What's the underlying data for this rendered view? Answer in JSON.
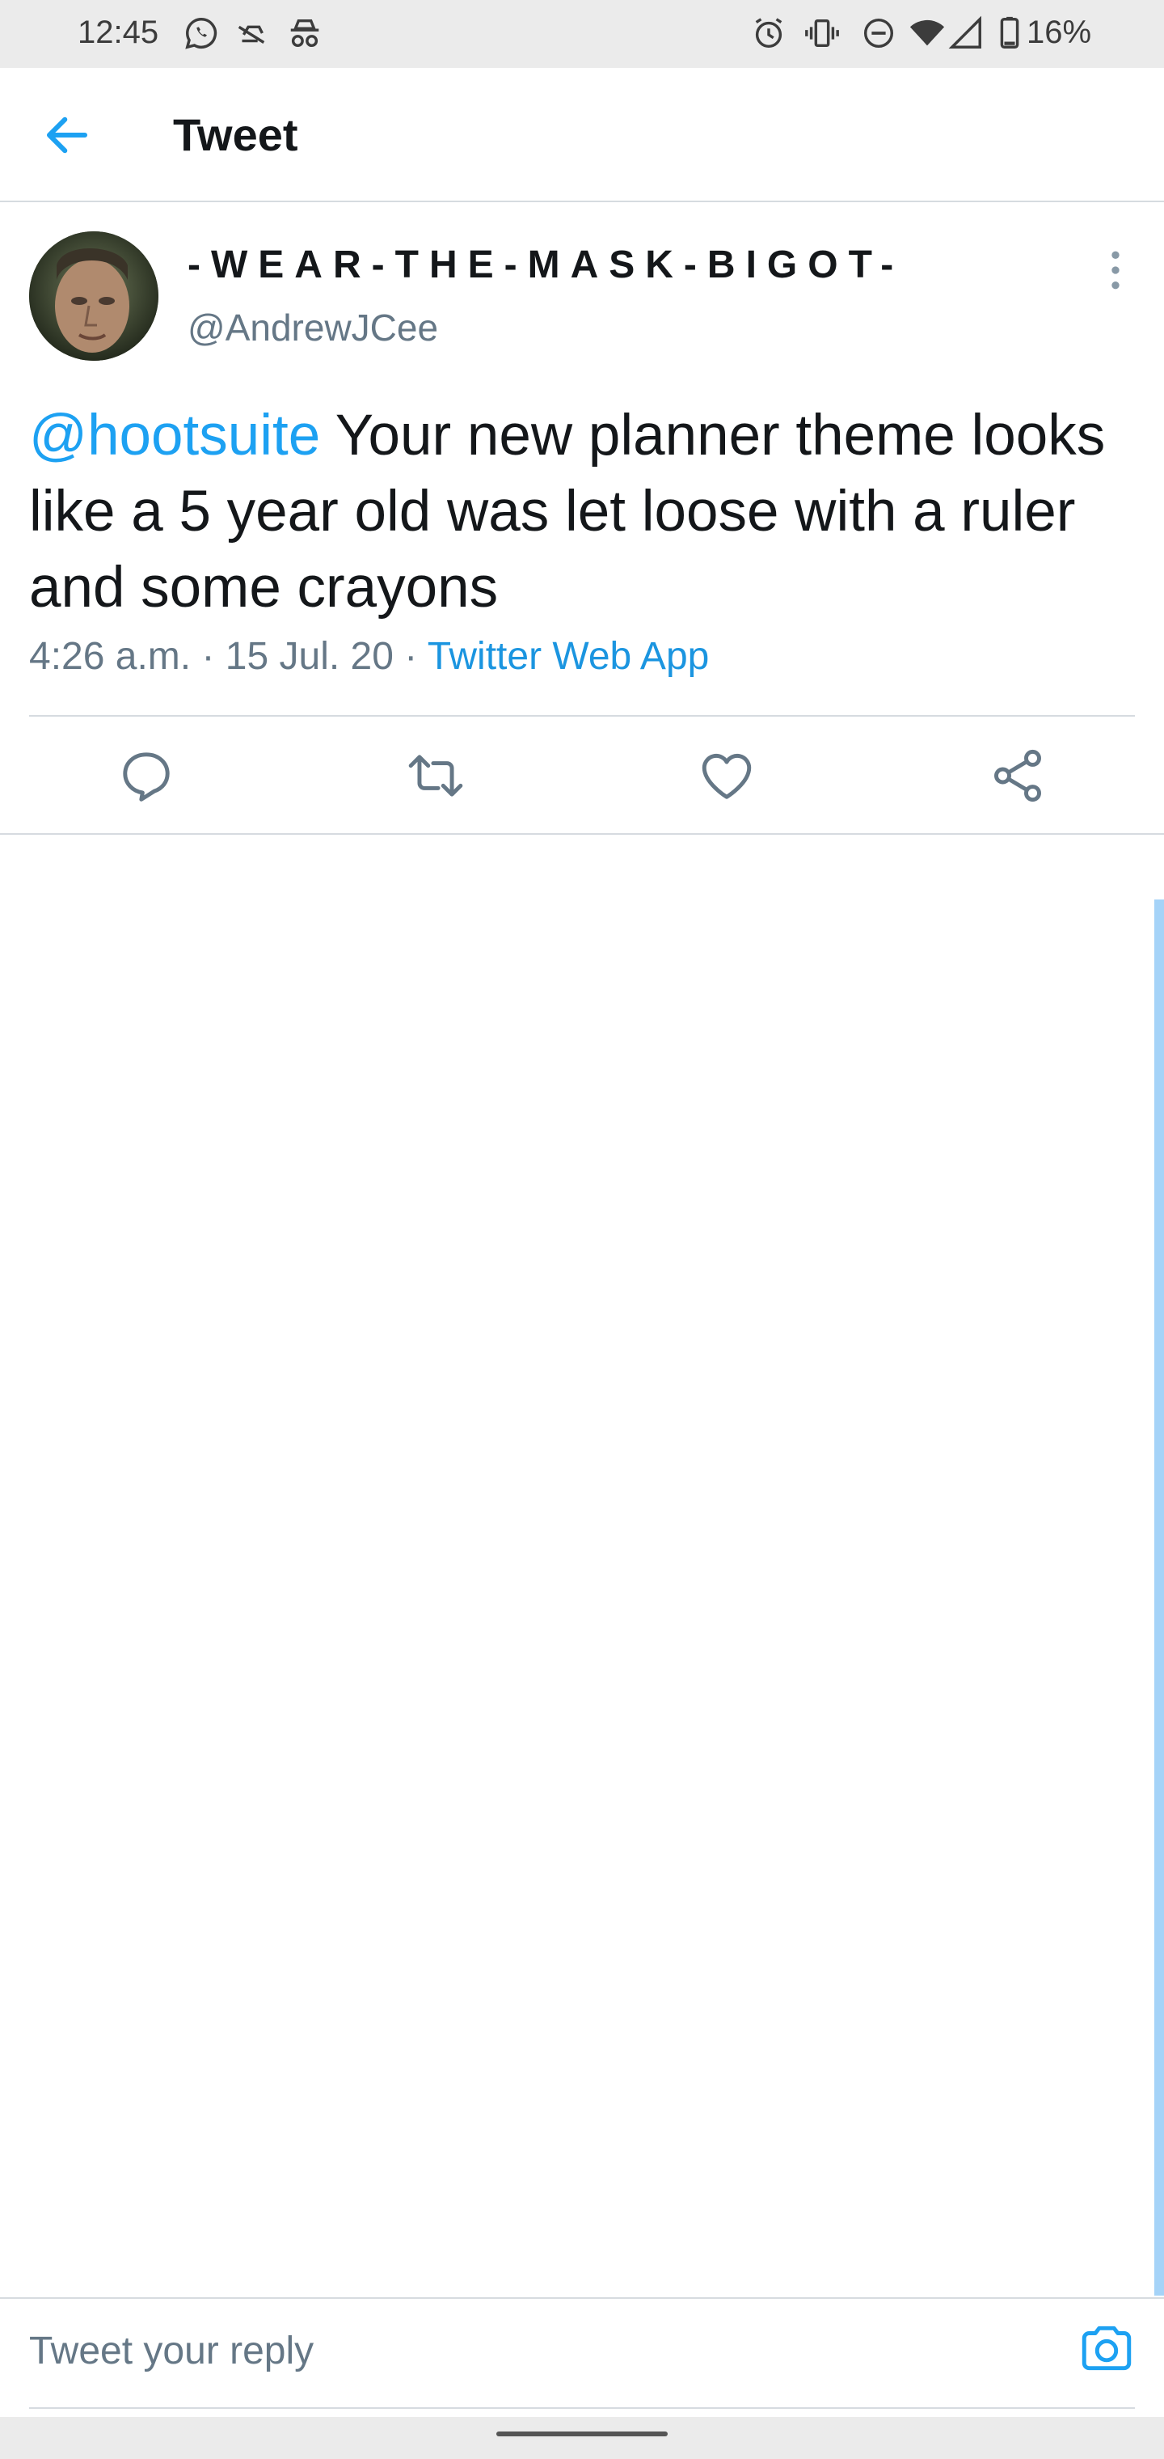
{
  "status_bar": {
    "time": "12:45",
    "battery_percent": "16%",
    "icons": [
      "whatsapp-icon",
      "sync-off-icon",
      "incognito-icon",
      "alarm-icon",
      "vibrate-icon",
      "do-not-disturb-icon",
      "wifi-icon",
      "cell-signal-icon",
      "battery-icon"
    ]
  },
  "app_bar": {
    "title": "Tweet",
    "back_icon": "arrow-left-icon"
  },
  "tweet": {
    "display_name": "-WEAR-THE-MASK-BIGOT-",
    "handle": "@AndrewJCee",
    "mention": "@hootsuite",
    "body": " Your new planner theme looks like a 5 year old was let loose with a ruler and some crayons",
    "time": "4:26 a.m.",
    "date": "15 Jul. 20",
    "separator": " · ",
    "source": "Twitter Web App"
  },
  "actions": [
    {
      "name": "reply",
      "icon": "comment-icon"
    },
    {
      "name": "retweet",
      "icon": "retweet-icon"
    },
    {
      "name": "like",
      "icon": "heart-icon"
    },
    {
      "name": "share",
      "icon": "share-icon"
    }
  ],
  "reply": {
    "placeholder": "Tweet your reply",
    "camera_icon": "camera-icon"
  },
  "colors": {
    "accent": "#1da1f2",
    "link": "#1b95e0",
    "text_primary": "#14171a",
    "text_secondary": "#657786",
    "divider": "#d6dbe0",
    "system_bar": "#ebebeb"
  }
}
